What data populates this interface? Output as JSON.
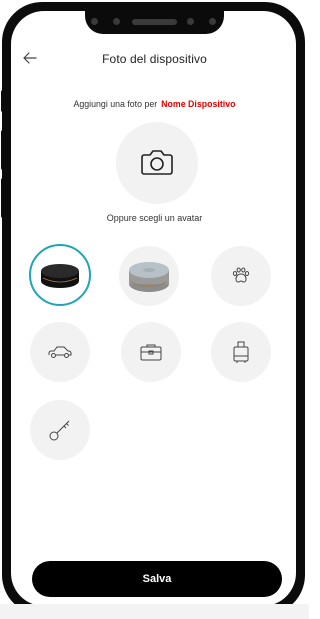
{
  "header": {
    "title": "Foto del dispositivo",
    "back_icon": "arrow-left-icon"
  },
  "photo": {
    "prompt": "Aggiungi una foto per",
    "device_name": "Nome Dispositivo",
    "device_name_color": "#e60000",
    "camera_icon": "camera-icon"
  },
  "avatars": {
    "label": "Oppure scegli un avatar",
    "selected_color": "#1fa5b5",
    "items": [
      {
        "icon": "black-tracker-icon",
        "selected": true
      },
      {
        "icon": "grey-tracker-icon",
        "selected": false
      },
      {
        "icon": "paw-icon",
        "selected": false
      },
      {
        "icon": "car-icon",
        "selected": false
      },
      {
        "icon": "briefcase-icon",
        "selected": false
      },
      {
        "icon": "luggage-icon",
        "selected": false
      },
      {
        "icon": "key-icon",
        "selected": false
      }
    ]
  },
  "footer": {
    "save_label": "Salva"
  }
}
